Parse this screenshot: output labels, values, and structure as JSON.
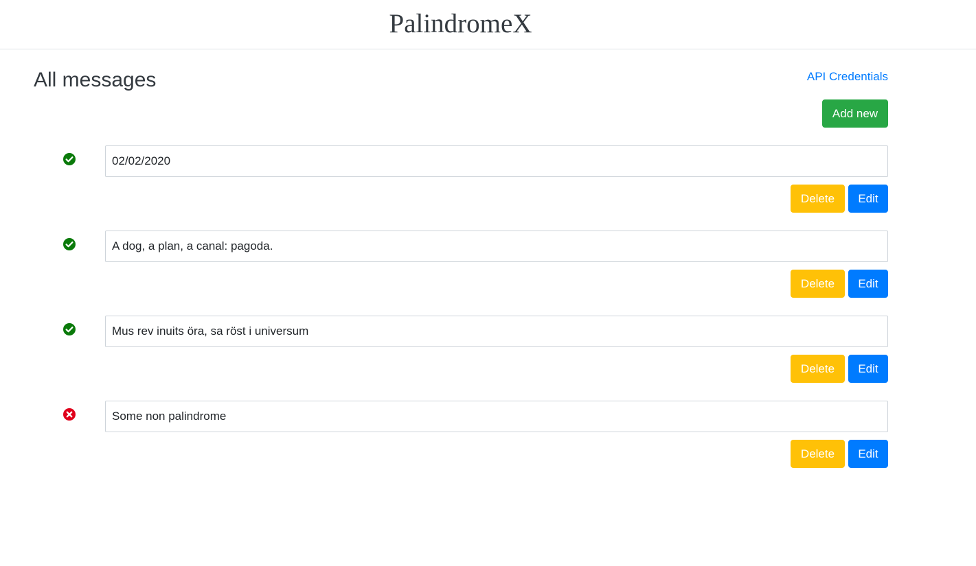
{
  "header": {
    "title": "PalindromeX"
  },
  "page": {
    "title": "All messages",
    "api_link_label": "API Credentials",
    "add_new_label": "Add new"
  },
  "messages": [
    {
      "text": "02/02/2020",
      "is_palindrome": true,
      "status_icon": "check-circle-icon",
      "delete_label": "Delete",
      "edit_label": "Edit"
    },
    {
      "text": "A dog, a plan, a canal: pagoda.",
      "is_palindrome": true,
      "status_icon": "check-circle-icon",
      "delete_label": "Delete",
      "edit_label": "Edit"
    },
    {
      "text": "Mus rev inuits öra, sa röst i universum",
      "is_palindrome": true,
      "status_icon": "check-circle-icon",
      "delete_label": "Delete",
      "edit_label": "Edit"
    },
    {
      "text": "Some non palindrome",
      "is_palindrome": false,
      "status_icon": "x-circle-icon",
      "delete_label": "Delete",
      "edit_label": "Edit"
    }
  ],
  "colors": {
    "success": "#28a745",
    "warning": "#ffc107",
    "primary": "#007bff",
    "check_icon": "#0a7a0a",
    "cross_icon": "#e0001b"
  }
}
